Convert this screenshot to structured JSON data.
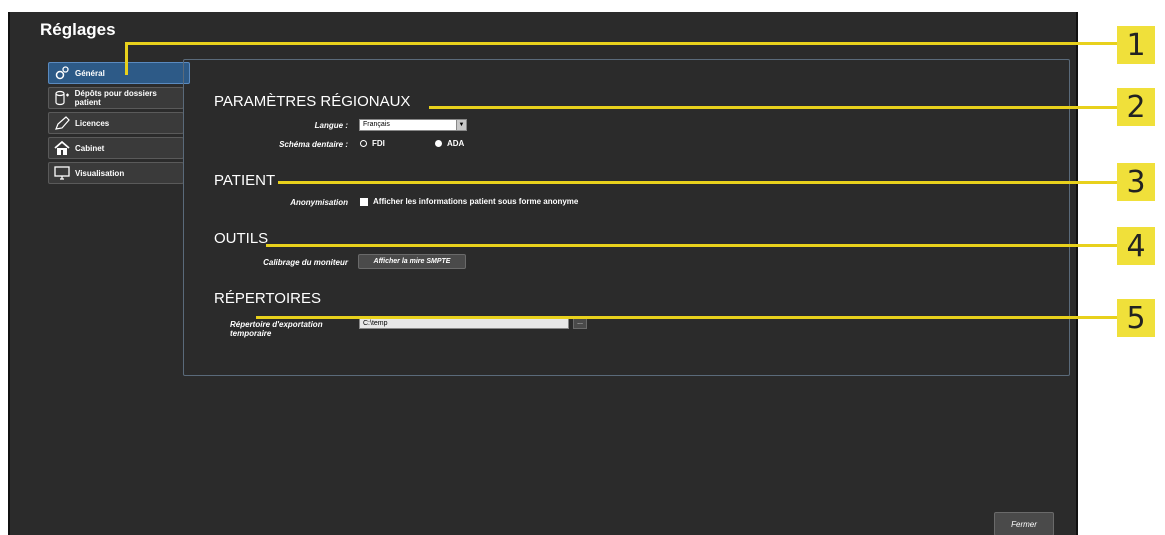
{
  "app": {
    "title": "Réglages",
    "close_label": "Fermer"
  },
  "sidebar": {
    "items": [
      {
        "label": "Général",
        "icon": "gears-icon",
        "active": true
      },
      {
        "label": "Dépôts pour dossiers patient",
        "icon": "database-icon",
        "active": false
      },
      {
        "label": "Licences",
        "icon": "pen-icon",
        "active": false
      },
      {
        "label": "Cabinet",
        "icon": "house-icon",
        "active": false
      },
      {
        "label": "Visualisation",
        "icon": "monitor-icon",
        "active": false
      }
    ]
  },
  "regional": {
    "title": "PARAMÈTRES RÉGIONAUX",
    "language_label": "Langue :",
    "language_value": "Français",
    "dental_scheme_label": "Schéma dentaire :",
    "scheme_options": [
      "FDI",
      "ADA"
    ],
    "scheme_selected": "ADA"
  },
  "patient": {
    "title": "PATIENT",
    "anonymisation_label": "Anonymisation",
    "anonymisation_checkbox_label": "Afficher les informations patient sous forme anonyme",
    "anonymisation_checked": false
  },
  "tools": {
    "title": "OUTILS",
    "monitor_calibration_label": "Calibrage du moniteur",
    "smpte_button_label": "Afficher la mire SMPTE"
  },
  "directories": {
    "title": "RÉPERTOIRES",
    "export_dir_label_line1": "Répertoire d'exportation",
    "export_dir_label_line2": "temporaire",
    "export_dir_value": "C:\\temp",
    "browse_label": "..."
  },
  "callouts": [
    "1",
    "2",
    "3",
    "4",
    "5"
  ],
  "colors": {
    "background": "#2b2b2b",
    "active_nav": "#2d5a87",
    "callout": "#f0e03a"
  }
}
